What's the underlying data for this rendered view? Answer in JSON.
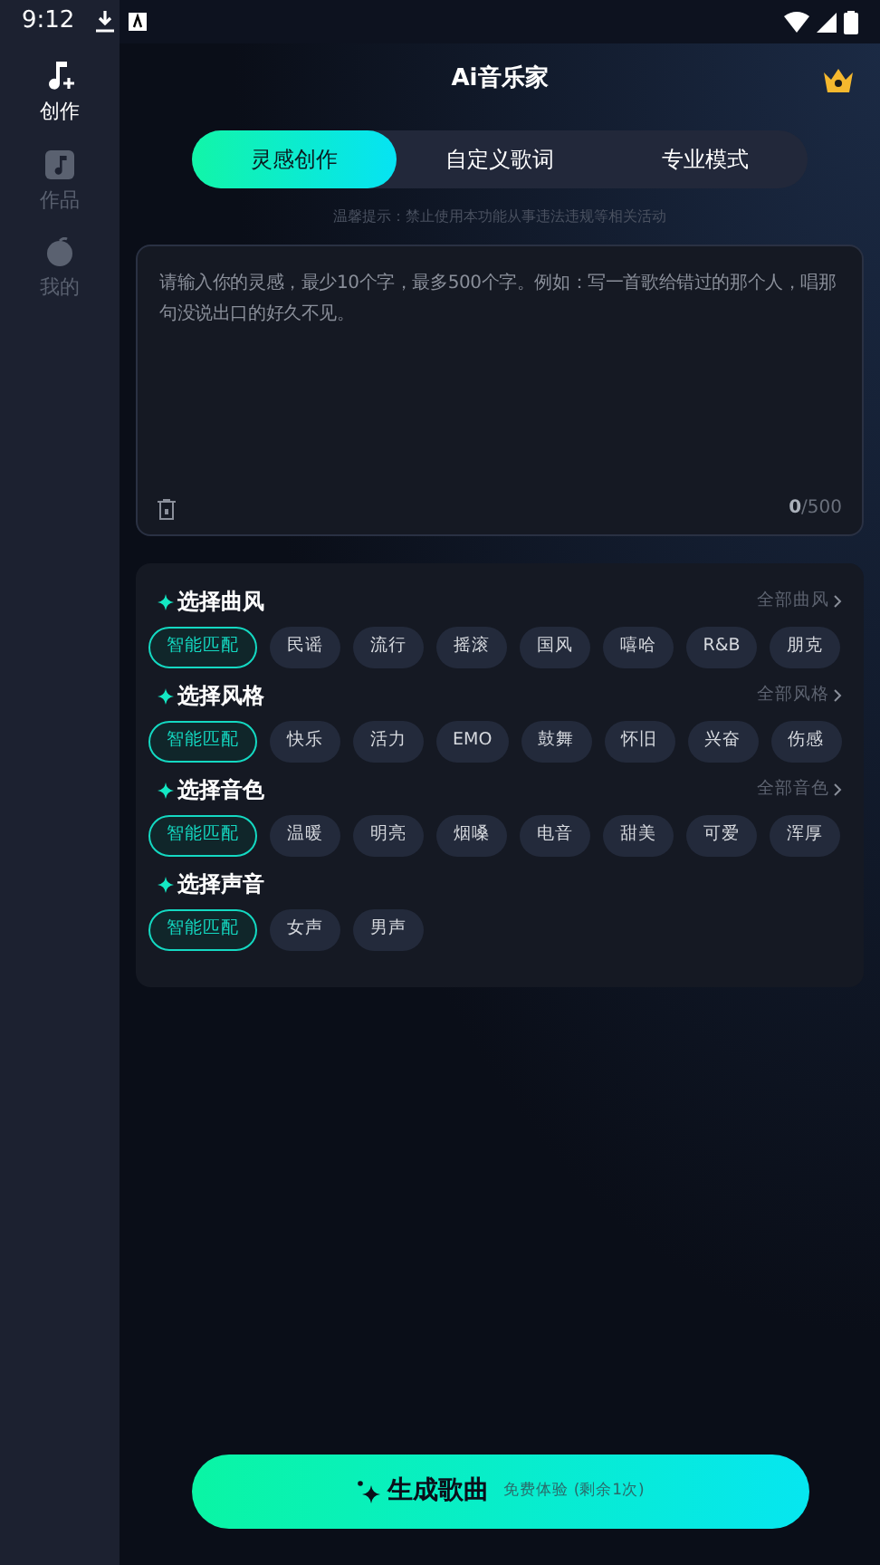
{
  "status_bar": {
    "time": "9:12"
  },
  "sidebar": {
    "items": [
      {
        "label": "创作",
        "selected": true,
        "kind": "music"
      },
      {
        "label": "作品",
        "selected": false,
        "kind": "works"
      },
      {
        "label": "我的",
        "selected": false,
        "kind": "me"
      }
    ]
  },
  "header": {
    "title": "Ai音乐家"
  },
  "tabs": [
    {
      "label": "灵感创作",
      "selected": true
    },
    {
      "label": "自定义歌词",
      "selected": false
    },
    {
      "label": "专业模式",
      "selected": false
    }
  ],
  "notice": "温馨提示：禁止使用本功能从事违法违规等相关活动",
  "prompt_field": {
    "placeholder": "请输入你的灵感，最少10个字，最多500个字。例如：写一首歌给错过的那个人，唱那句没说出口的好久不见。",
    "count": "0",
    "max": "/500"
  },
  "sections": [
    {
      "title": "选择曲风",
      "more": "全部曲风",
      "options": [
        {
          "label": "智能匹配",
          "selected": true
        },
        {
          "label": "民谣",
          "selected": false
        },
        {
          "label": "流行",
          "selected": false
        },
        {
          "label": "摇滚",
          "selected": false
        },
        {
          "label": "国风",
          "selected": false
        },
        {
          "label": "嘻哈",
          "selected": false
        },
        {
          "label": "R&B",
          "selected": false
        },
        {
          "label": "朋克",
          "selected": false
        }
      ]
    },
    {
      "title": "选择风格",
      "more": "全部风格",
      "options": [
        {
          "label": "智能匹配",
          "selected": true
        },
        {
          "label": "快乐",
          "selected": false
        },
        {
          "label": "活力",
          "selected": false
        },
        {
          "label": "EMO",
          "selected": false
        },
        {
          "label": "鼓舞",
          "selected": false
        },
        {
          "label": "怀旧",
          "selected": false
        },
        {
          "label": "兴奋",
          "selected": false
        },
        {
          "label": "伤感",
          "selected": false
        }
      ]
    },
    {
      "title": "选择音色",
      "more": "全部音色",
      "options": [
        {
          "label": "智能匹配",
          "selected": true
        },
        {
          "label": "温暖",
          "selected": false
        },
        {
          "label": "明亮",
          "selected": false
        },
        {
          "label": "烟嗓",
          "selected": false
        },
        {
          "label": "电音",
          "selected": false
        },
        {
          "label": "甜美",
          "selected": false
        },
        {
          "label": "可爱",
          "selected": false
        },
        {
          "label": "浑厚",
          "selected": false
        }
      ]
    },
    {
      "title": "选择声音",
      "options": [
        {
          "label": "智能匹配",
          "selected": true
        },
        {
          "label": "女声",
          "selected": false
        },
        {
          "label": "男声",
          "selected": false
        }
      ]
    }
  ],
  "generate_button": {
    "label": "生成歌曲",
    "note": "免费体验 (剩余1次)"
  }
}
